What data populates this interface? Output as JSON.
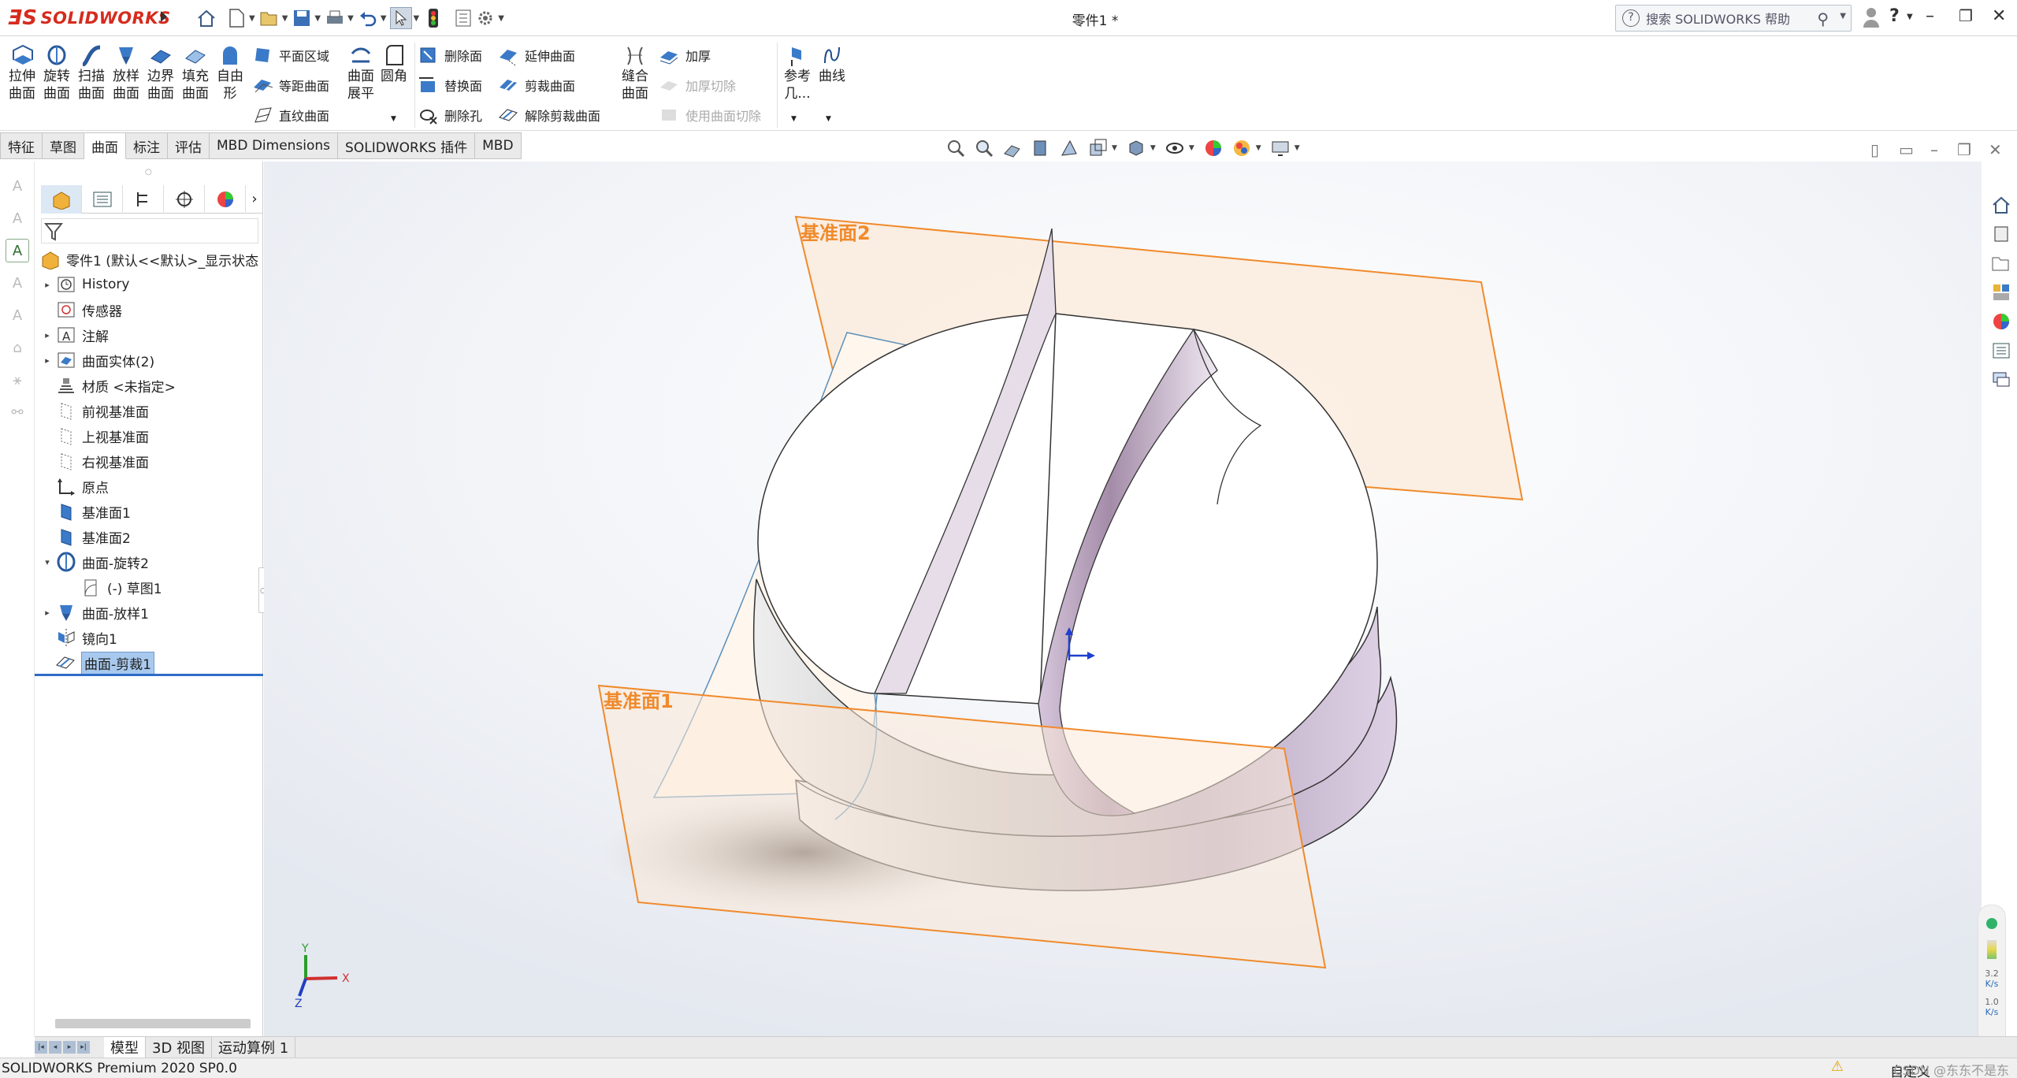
{
  "app": {
    "brand": "SOLIDWORKS",
    "doc_title": "零件1 *"
  },
  "search": {
    "placeholder": "搜索 SOLIDWORKS 帮助"
  },
  "commands": {
    "extrude": "拉伸\n曲面",
    "revolve": "旋转\n曲面",
    "sweep": "扫描\n曲面",
    "loft": "放样\n曲面",
    "boundary": "边界\n曲面",
    "fill": "填充\n曲面",
    "freeform": "自由\n形",
    "planar": "平面区域",
    "offset": "等距曲面",
    "ruled": "直纹曲面",
    "flatten": "曲面\n展平",
    "fillet": "圆角",
    "delete_face": "删除面",
    "replace_face": "替换面",
    "delete_hole": "删除孔",
    "extend": "延伸曲面",
    "trim": "剪裁曲面",
    "untrim": "解除剪裁曲面",
    "knit": "缝合\n曲面",
    "thicken": "加厚",
    "thicken_cut": "加厚切除",
    "cut_with_surface": "使用曲面切除",
    "ref_geom": "参考\n几...",
    "curves": "曲线"
  },
  "tabs": [
    "特征",
    "草图",
    "曲面",
    "标注",
    "评估",
    "MBD Dimensions",
    "SOLIDWORKS 插件",
    "MBD"
  ],
  "active_tab": "曲面",
  "tree": {
    "root": "零件1 (默认<<默认>_显示状态",
    "nodes": [
      {
        "label": "History",
        "expand": "▸",
        "icon": "history-icon"
      },
      {
        "label": "传感器",
        "expand": "",
        "icon": "sensor-icon"
      },
      {
        "label": "注解",
        "expand": "▸",
        "icon": "annotation-icon"
      },
      {
        "label": "曲面实体(2)",
        "expand": "▸",
        "icon": "surface-bodies-icon"
      },
      {
        "label": "材质 <未指定>",
        "expand": "",
        "icon": "material-icon"
      },
      {
        "label": "前视基准面",
        "expand": "",
        "icon": "plane-icon"
      },
      {
        "label": "上视基准面",
        "expand": "",
        "icon": "plane-icon"
      },
      {
        "label": "右视基准面",
        "expand": "",
        "icon": "plane-icon"
      },
      {
        "label": "原点",
        "expand": "",
        "icon": "origin-icon"
      },
      {
        "label": "基准面1",
        "expand": "",
        "icon": "ref-plane-icon"
      },
      {
        "label": "基准面2",
        "expand": "",
        "icon": "ref-plane-icon"
      },
      {
        "label": "曲面-旋转2",
        "expand": "▾",
        "icon": "revolve-surface-icon"
      },
      {
        "label": "(-) 草图1",
        "expand": "",
        "icon": "sketch-icon",
        "indent": true
      },
      {
        "label": "曲面-放样1",
        "expand": "▸",
        "icon": "loft-surface-icon"
      },
      {
        "label": "镜向1",
        "expand": "",
        "icon": "mirror-icon"
      },
      {
        "label": "曲面-剪裁1",
        "expand": "",
        "icon": "trim-surface-icon",
        "selected": true
      }
    ]
  },
  "viewport": {
    "plane1_label": "基准面1",
    "plane2_label": "基准面2",
    "triad": {
      "x": "X",
      "y": "Y",
      "z": "Z"
    }
  },
  "model_tabs": [
    "模型",
    "3D 视图",
    "运动算例 1"
  ],
  "active_model_tab": "模型",
  "status": {
    "left": "SOLIDWORKS Premium 2020 SP0.0",
    "right": "自定义",
    "watermark": "CSDN @东东不是东"
  },
  "perf": {
    "v1": "3.2",
    "u1": "K/s",
    "v2": "1.0",
    "u2": "K/s"
  },
  "colors": {
    "brand_red": "#d52b1e",
    "plane_orange": "#f08a2b",
    "selection_blue": "#a8c9ee",
    "model_face": "#ffffff",
    "model_side": "#b9a6c0"
  }
}
